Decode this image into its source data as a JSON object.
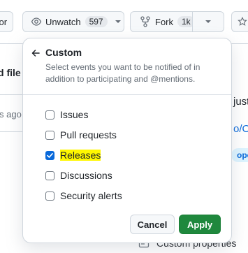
{
  "header": {
    "sponsor_fragment": "sor",
    "unwatch_label": "Unwatch",
    "unwatch_count": "597",
    "fork_label": "Fork",
    "fork_count": "1k"
  },
  "background": {
    "file_fragment": "d file",
    "ago_fragment": "s ago",
    "just_fragment": "just",
    "link_fragment": "o/Op",
    "pill_fragment": "ope",
    "bottom_item": "Custom properties"
  },
  "menu": {
    "title": "Custom",
    "description": "Select events you want to be notified of in addition to participating and @mentions.",
    "options": [
      {
        "label": "Issues",
        "checked": false
      },
      {
        "label": "Pull requests",
        "checked": false
      },
      {
        "label": "Releases",
        "checked": true
      },
      {
        "label": "Discussions",
        "checked": false
      },
      {
        "label": "Security alerts",
        "checked": false
      }
    ],
    "cancel_label": "Cancel",
    "apply_label": "Apply"
  },
  "colors": {
    "accent": "#0969da",
    "apply_green": "#1f883d",
    "highlight": "#fff700"
  }
}
